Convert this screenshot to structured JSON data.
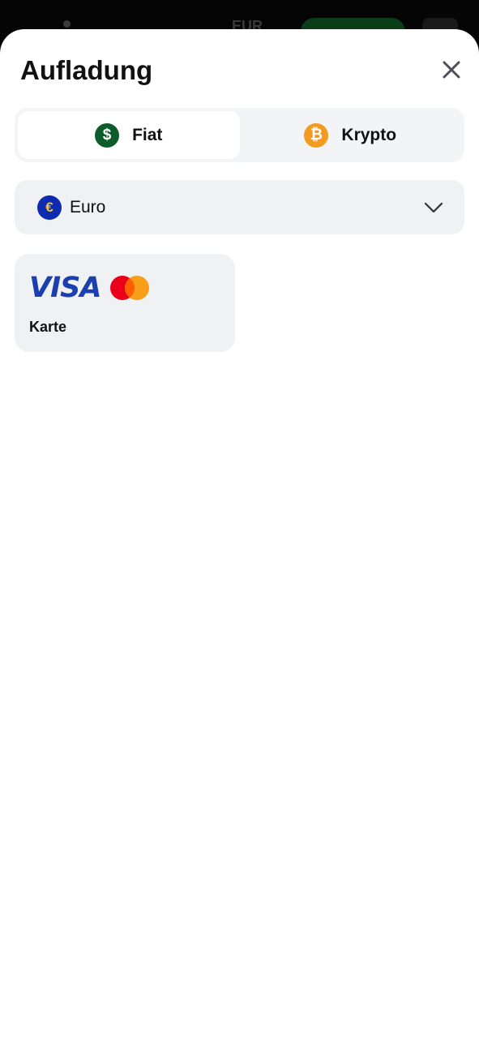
{
  "background": {
    "currency": "EUR"
  },
  "sheet": {
    "title": "Aufladung",
    "tabs": [
      {
        "label": "Fiat",
        "icon": "dollar-coin-icon",
        "active": true
      },
      {
        "label": "Krypto",
        "icon": "bitcoin-icon",
        "active": false
      }
    ],
    "currency_select": {
      "value": "Euro",
      "icon": "euro-coin-icon"
    },
    "payment_methods": [
      {
        "label": "Karte",
        "brands": [
          "VISA",
          "mastercard"
        ]
      }
    ]
  },
  "colors": {
    "fiat_icon": "#0d5c2b",
    "crypto_icon": "#f39a20",
    "euro_icon": "#0e2bb0",
    "visa_blue": "#1a3fae"
  }
}
